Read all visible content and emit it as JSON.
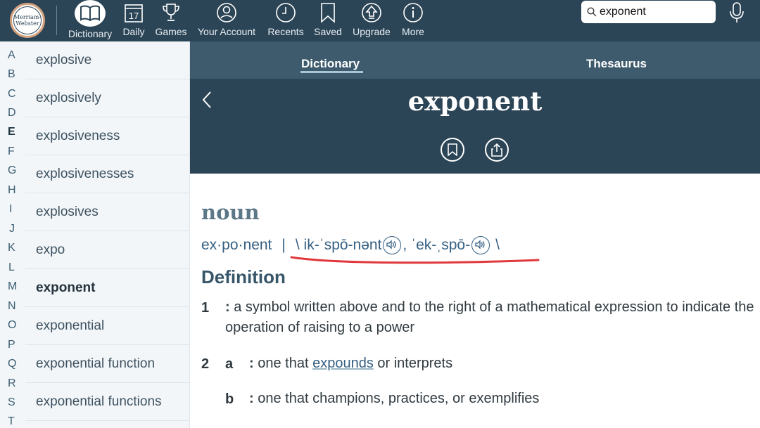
{
  "logo": {
    "line1": "Merriam-",
    "line2": "Webster"
  },
  "nav": [
    {
      "label": "Dictionary",
      "icon": "book-icon",
      "active": true
    },
    {
      "label": "Daily",
      "icon": "calendar-icon",
      "date": "17"
    },
    {
      "label": "Games",
      "icon": "trophy-icon"
    },
    {
      "label": "Your Account",
      "icon": "user-icon"
    },
    {
      "label": "Recents",
      "icon": "clock-icon"
    },
    {
      "label": "Saved",
      "icon": "bookmark-icon"
    },
    {
      "label": "Upgrade",
      "icon": "upgrade-icon"
    },
    {
      "label": "More",
      "icon": "info-icon"
    }
  ],
  "search": {
    "value": "exponent"
  },
  "letters": [
    "A",
    "B",
    "C",
    "D",
    "E",
    "F",
    "G",
    "H",
    "I",
    "J",
    "K",
    "L",
    "M",
    "N",
    "O",
    "P",
    "Q",
    "R",
    "S",
    "T"
  ],
  "active_letter": "E",
  "words": [
    "explosive",
    "explosively",
    "explosiveness",
    "explosivenesses",
    "explosives",
    "expo",
    "exponent",
    "exponential",
    "exponential function",
    "exponential functions"
  ],
  "selected_word": "exponent",
  "tabs": {
    "dictionary": "Dictionary",
    "thesaurus": "Thesaurus"
  },
  "entry": {
    "headword": "exponent",
    "part_of_speech": "noun",
    "syllables": "ex·po·nent",
    "separator": "|",
    "pron_open": "\\ ik-ˈspō-nənt",
    "pron_mid": ", ˈek-ˌspō-",
    "pron_close": "\\",
    "definition_heading": "Definition",
    "senses": [
      {
        "num": "1",
        "colon": ":",
        "text": " a symbol written above and to the right of a mathematical expression to indicate the operation of raising to a power"
      },
      {
        "num": "2",
        "sub": "a",
        "colon": ":",
        "before": " one that ",
        "xref": "expounds",
        "after": " or interprets"
      },
      {
        "sub": "b",
        "colon": ":",
        "text": " one that champions, practices, or exemplifies"
      }
    ]
  },
  "colors": {
    "header": "#2c4556",
    "tab_bar": "#3e5b6e",
    "sidebar": "#f2f6f9",
    "annotation": "#e0383b"
  }
}
